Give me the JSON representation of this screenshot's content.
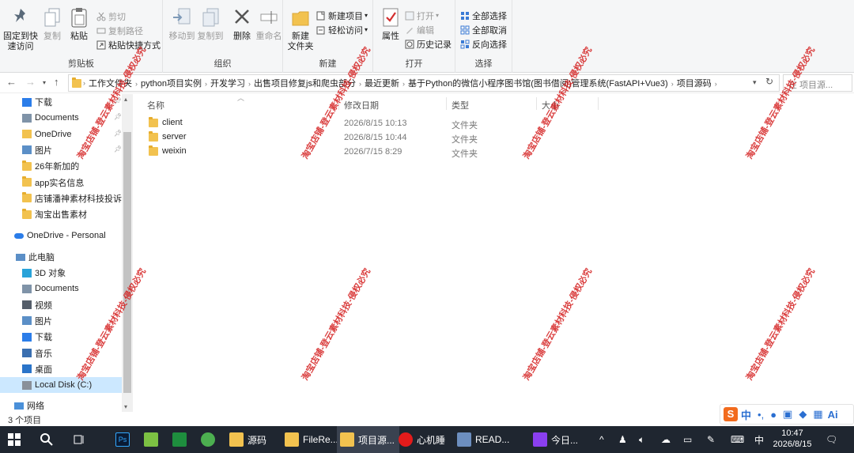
{
  "ribbon": {
    "clipboard": {
      "pin_label_1": "固定到快",
      "pin_label_2": "速访问",
      "copy_label": "复制",
      "paste_label": "粘贴",
      "cut_label": "剪切",
      "copy_path_label": "复制路径",
      "paste_shortcut_label": "粘贴快捷方式",
      "group_label": "剪贴板"
    },
    "organize": {
      "move_to_label": "移动到",
      "copy_to_label": "复制到",
      "delete_label": "删除",
      "rename_label": "重命名",
      "group_label": "组织"
    },
    "new": {
      "new_folder_label_1": "新建",
      "new_folder_label_2": "文件夹",
      "new_item_label": "新建项目",
      "easy_access_label": "轻松访问",
      "group_label": "新建"
    },
    "open": {
      "properties_label": "属性",
      "open_label": "打开",
      "edit_label": "编辑",
      "history_label": "历史记录",
      "group_label": "打开"
    },
    "select": {
      "select_all_label": "全部选择",
      "select_none_label": "全部取消",
      "invert_label": "反向选择",
      "group_label": "选择"
    }
  },
  "address": {
    "crumbs": [
      "工作文件夹",
      "python项目实例",
      "开发学习",
      "出售项目修复js和爬虫部分",
      "最近更新",
      "基于Python的微信小程序图书馆(图书借阅)管理系统(FastAPI+Vue3)",
      "项目源码"
    ],
    "search_placeholder": "在 项目源..."
  },
  "nav": {
    "quick": [
      {
        "label": "下载",
        "pinned": true
      },
      {
        "label": "Documents",
        "pinned": true
      },
      {
        "label": "OneDrive",
        "pinned": true
      },
      {
        "label": "图片",
        "pinned": true
      },
      {
        "label": "26年新加的",
        "pinned": false
      },
      {
        "label": "app实名信息",
        "pinned": false
      },
      {
        "label": "店铺潘神素材科技投诉资",
        "pinned": false
      },
      {
        "label": "淘宝出售素材",
        "pinned": false
      }
    ],
    "onedrive_personal": "OneDrive - Personal",
    "this_pc": "此电脑",
    "pc_items": [
      "3D 对象",
      "Documents",
      "视频",
      "图片",
      "下载",
      "音乐",
      "桌面",
      "Local Disk (C:)"
    ],
    "network": "网络"
  },
  "filelist": {
    "headers": {
      "name": "名称",
      "date": "修改日期",
      "type": "类型",
      "size": "大小"
    },
    "rows": [
      {
        "name": "client",
        "date": "2026/8/15 10:13",
        "type": "文件夹"
      },
      {
        "name": "server",
        "date": "2026/8/15 10:44",
        "type": "文件夹"
      },
      {
        "name": "weixin",
        "date": "2026/7/15 8:29",
        "type": "文件夹"
      }
    ]
  },
  "status": {
    "item_count": "3 个项目"
  },
  "taskbar": {
    "apps": [
      "源码",
      "FileRe...",
      "项目源...",
      "心机睡",
      "READ...",
      "今日..."
    ],
    "ime_indicator": "中",
    "time": "10:47",
    "date": "2026/8/15"
  },
  "ime": {
    "mode": "中",
    "ai": "Ai"
  },
  "watermark": "淘宝店铺-登云素材科技-侵权必究",
  "colors": {
    "accent": "#0078d7",
    "folder": "#f2c24f",
    "taskbar": "#1f2630",
    "watermark": "#d41e1e"
  }
}
